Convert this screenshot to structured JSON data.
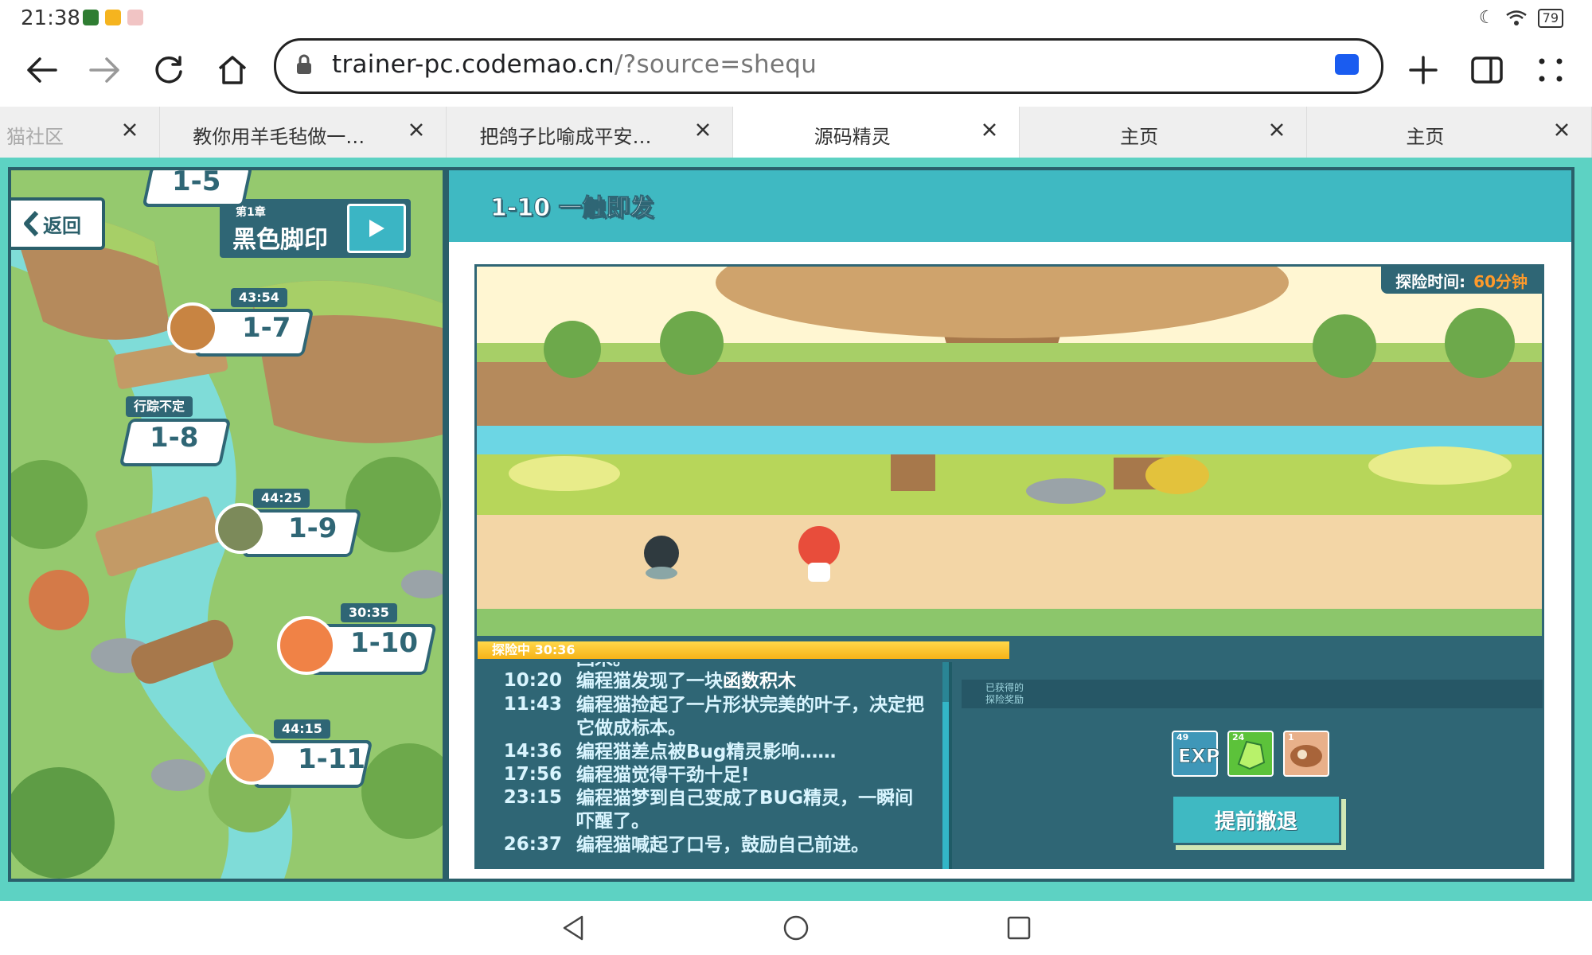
{
  "status_bar": {
    "time": "21:38",
    "battery": "79",
    "icons": [
      "app-notification-icon",
      "shield-app-icon",
      "gift-app-icon",
      "moon-icon",
      "wifi-icon",
      "battery-icon"
    ]
  },
  "browser": {
    "url_host": "trainer-pc.codemao.cn",
    "url_path": "/?source=shequ",
    "tabs": [
      {
        "label": "猫社区",
        "active": false
      },
      {
        "label": "教你用羊毛毡做一…",
        "active": false
      },
      {
        "label": "把鸽子比喻成平安…",
        "active": false
      },
      {
        "label": "源码精灵",
        "active": true
      },
      {
        "label": "主页",
        "active": false
      },
      {
        "label": "主页",
        "active": false
      }
    ]
  },
  "map": {
    "back_label": "返回",
    "chapter_no": "第1章",
    "chapter_name": "黑色脚印",
    "nodes": {
      "n15": {
        "label": "1-5"
      },
      "n17": {
        "label": "1-7",
        "timer": "43:54"
      },
      "n18": {
        "label": "1-8",
        "status": "行踪不定"
      },
      "n19": {
        "label": "1-9",
        "timer": "44:25"
      },
      "n110": {
        "label": "1-10",
        "timer": "30:35"
      },
      "n111": {
        "label": "1-11",
        "timer": "44:15"
      }
    }
  },
  "panel": {
    "title": "1-10 一触即发",
    "explore_time_label": "探险时间:",
    "explore_time_value": "60分钟",
    "progress_text": "探险中 30:36",
    "progress": 0.5,
    "log_partial": "回来。",
    "log": [
      {
        "time": "10:20",
        "text": "编程猫发现了一块",
        "highlight": "函数积木"
      },
      {
        "time": "11:43",
        "text": "编程猫捡起了一片形状完美的叶子，决定把它做成标本。",
        "highlight": ""
      },
      {
        "time": "14:36",
        "text": "编程猫差点被Bug精灵影响……",
        "highlight": ""
      },
      {
        "time": "17:56",
        "text": "编程猫觉得干劲十足!",
        "highlight": ""
      },
      {
        "time": "23:15",
        "text": "编程猫梦到自己变成了BUG精灵，一瞬间吓醒了。",
        "highlight": ""
      },
      {
        "time": "26:37",
        "text": "编程猫喊起了口号，鼓励自己前进。",
        "highlight": ""
      }
    ],
    "rewards_label_1": "已获得的",
    "rewards_label_2": "探险奖励",
    "rewards": [
      {
        "name": "exp",
        "count": "49",
        "caption": "EXP"
      },
      {
        "name": "crystal",
        "count": "24",
        "caption": ""
      },
      {
        "name": "cookie",
        "count": "1",
        "caption": ""
      }
    ],
    "retreat_label": "提前撤退"
  },
  "colors": {
    "teal": "#3fb9c2",
    "dark_teal": "#2f6675",
    "accent_orange": "#ff9a2a"
  }
}
